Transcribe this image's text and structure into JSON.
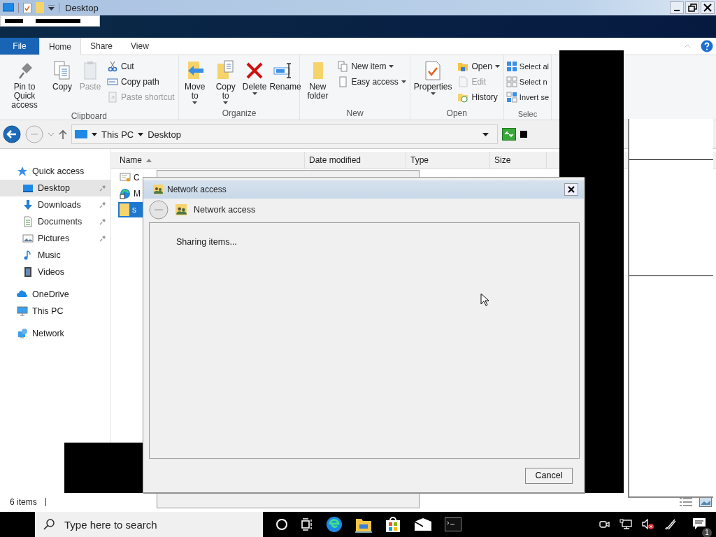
{
  "title_bar": {
    "title": "Desktop"
  },
  "ribbon": {
    "tabs": [
      {
        "label": "File",
        "kind": "file",
        "selected": false
      },
      {
        "label": "Home",
        "kind": "tab",
        "selected": true
      },
      {
        "label": "Share",
        "kind": "tab",
        "selected": false
      },
      {
        "label": "View",
        "kind": "tab",
        "selected": false
      }
    ],
    "groups": [
      {
        "label": "Clipboard",
        "large": [
          {
            "label": "Pin to Quick access",
            "disabled": false,
            "dropdown": false
          },
          {
            "label": "Copy",
            "disabled": false,
            "dropdown": false
          },
          {
            "label": "Paste",
            "disabled": true,
            "dropdown": false
          }
        ],
        "small": [
          {
            "label": "Cut",
            "disabled": false,
            "dropdown": false
          },
          {
            "label": "Copy path",
            "disabled": false,
            "dropdown": false
          },
          {
            "label": "Paste shortcut",
            "disabled": true,
            "dropdown": false
          }
        ]
      },
      {
        "label": "Organize",
        "large": [
          {
            "label": "Move to",
            "disabled": false,
            "dropdown": true
          },
          {
            "label": "Copy to",
            "disabled": false,
            "dropdown": true
          },
          {
            "label": "Delete",
            "disabled": false,
            "dropdown": true
          },
          {
            "label": "Rename",
            "disabled": false,
            "dropdown": false
          }
        ]
      },
      {
        "label": "New",
        "large": [
          {
            "label": "New folder",
            "disabled": false,
            "dropdown": false
          }
        ],
        "small": [
          {
            "label": "New item",
            "disabled": false,
            "dropdown": true
          },
          {
            "label": "Easy access",
            "disabled": false,
            "dropdown": true
          }
        ]
      },
      {
        "label": "Open",
        "large": [
          {
            "label": "Properties",
            "disabled": false,
            "dropdown": true
          }
        ],
        "small": [
          {
            "label": "Open",
            "disabled": false,
            "dropdown": true
          },
          {
            "label": "Edit",
            "disabled": true,
            "dropdown": false
          },
          {
            "label": "History",
            "disabled": false,
            "dropdown": false
          }
        ]
      },
      {
        "label": "Selec",
        "small": [
          {
            "label": "Select al",
            "disabled": false,
            "dropdown": false
          },
          {
            "label": "Select n",
            "disabled": false,
            "dropdown": false
          },
          {
            "label": "Invert se",
            "disabled": false,
            "dropdown": false
          }
        ]
      }
    ]
  },
  "address_bar": {
    "crumbs": [
      "This PC",
      "Desktop"
    ]
  },
  "navigation": [
    {
      "label": "Quick access",
      "selected": false,
      "children": [
        {
          "label": "Desktop",
          "selected": true,
          "pinned": true
        },
        {
          "label": "Downloads",
          "selected": false,
          "pinned": true
        },
        {
          "label": "Documents",
          "selected": false,
          "pinned": true
        },
        {
          "label": "Pictures",
          "selected": false,
          "pinned": true
        },
        {
          "label": "Music",
          "selected": false,
          "pinned": false
        },
        {
          "label": "Videos",
          "selected": false,
          "pinned": false
        }
      ]
    },
    {
      "label": "OneDrive",
      "selected": false
    },
    {
      "label": "This PC",
      "selected": false
    },
    {
      "label": "Network",
      "selected": false
    }
  ],
  "file_list": {
    "columns": [
      {
        "label": "Name",
        "sorted": true
      },
      {
        "label": "Date modified",
        "sorted": false
      },
      {
        "label": "Type",
        "sorted": false
      },
      {
        "label": "Size",
        "sorted": false
      }
    ],
    "rows": [
      {
        "name": "C",
        "selected": false
      },
      {
        "name": "M",
        "selected": false
      },
      {
        "name": "s",
        "selected": true
      }
    ]
  },
  "status_bar": {
    "count": "6 items"
  },
  "dialog": {
    "title": "Network access",
    "heading": "Network access",
    "message": "Sharing items...",
    "buttons": [
      "Cancel"
    ]
  },
  "taskbar": {
    "search_placeholder": "Type here to search",
    "notification_count": "1"
  }
}
